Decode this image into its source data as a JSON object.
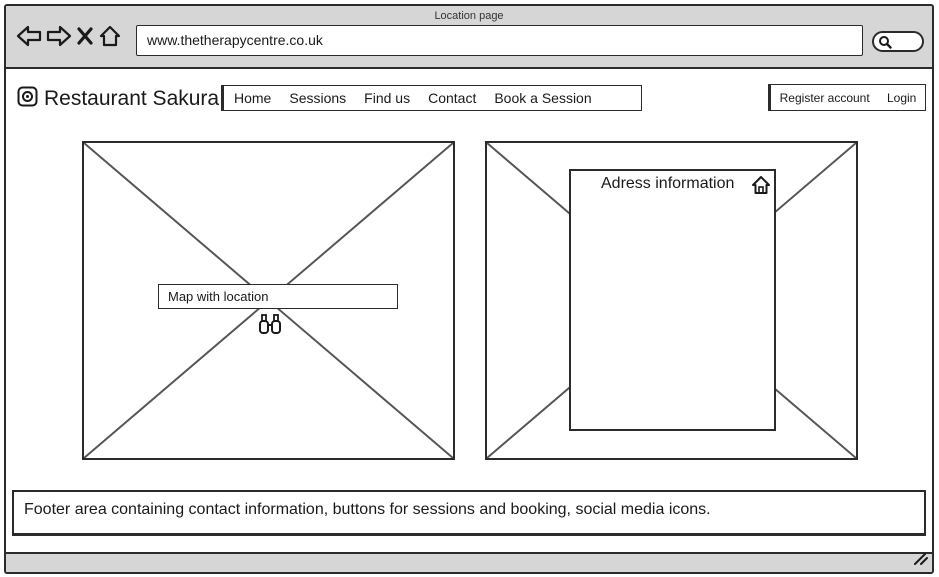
{
  "window": {
    "title": "Location page"
  },
  "browser": {
    "url": "www.thetherapycentre.co.uk",
    "icons": [
      "back-arrow-icon",
      "forward-arrow-icon",
      "close-icon",
      "home-icon",
      "search-icon"
    ]
  },
  "header": {
    "brand": "Restaurant Sakura",
    "brand_icon": "logo-icon",
    "nav": [
      "Home",
      "Sessions",
      "Find us",
      "Contact",
      "Book a Session"
    ],
    "account": {
      "register": "Register account",
      "login": "Login"
    }
  },
  "main": {
    "map": {
      "label": "Map with location",
      "icon": "binoculars-icon"
    },
    "address": {
      "title": "Adress information",
      "icon": "home-icon"
    }
  },
  "footer": {
    "text": "Footer area containing contact information, buttons for sessions and booking, social media icons."
  },
  "colors": {
    "chrome": "#d6d6d6",
    "stroke": "#2b2b2b",
    "background": "#ffffff"
  }
}
